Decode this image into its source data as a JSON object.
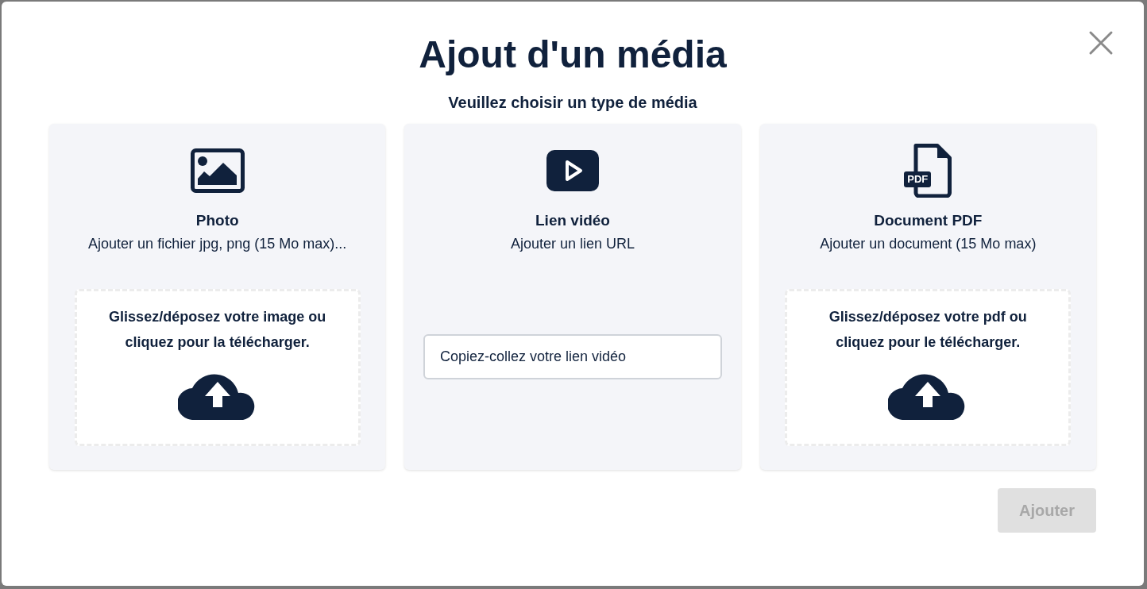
{
  "dialog": {
    "title": "Ajout d'un média",
    "subtitle": "Veuillez choisir un type de média"
  },
  "cards": [
    {
      "kind": "image_upload",
      "name": "Photo",
      "description": "Ajouter un fichier jpg, png (15 Mo max)...",
      "dropzone_text": "Glissez/déposez votre image ou cliquez pour la télécharger."
    },
    {
      "kind": "video_link",
      "name": "Lien vidéo",
      "description": "Ajouter un lien URL",
      "placeholder": "Copiez-collez votre lien vidéo"
    },
    {
      "kind": "pdf_upload",
      "icon_label": "PDF",
      "name": "Document PDF",
      "description": "Ajouter un document (15 Mo max)",
      "dropzone_text": "Glissez/déposez votre pdf ou cliquez pour le télécharger."
    }
  ],
  "submit": {
    "label": "Ajouter",
    "disabled": true
  }
}
